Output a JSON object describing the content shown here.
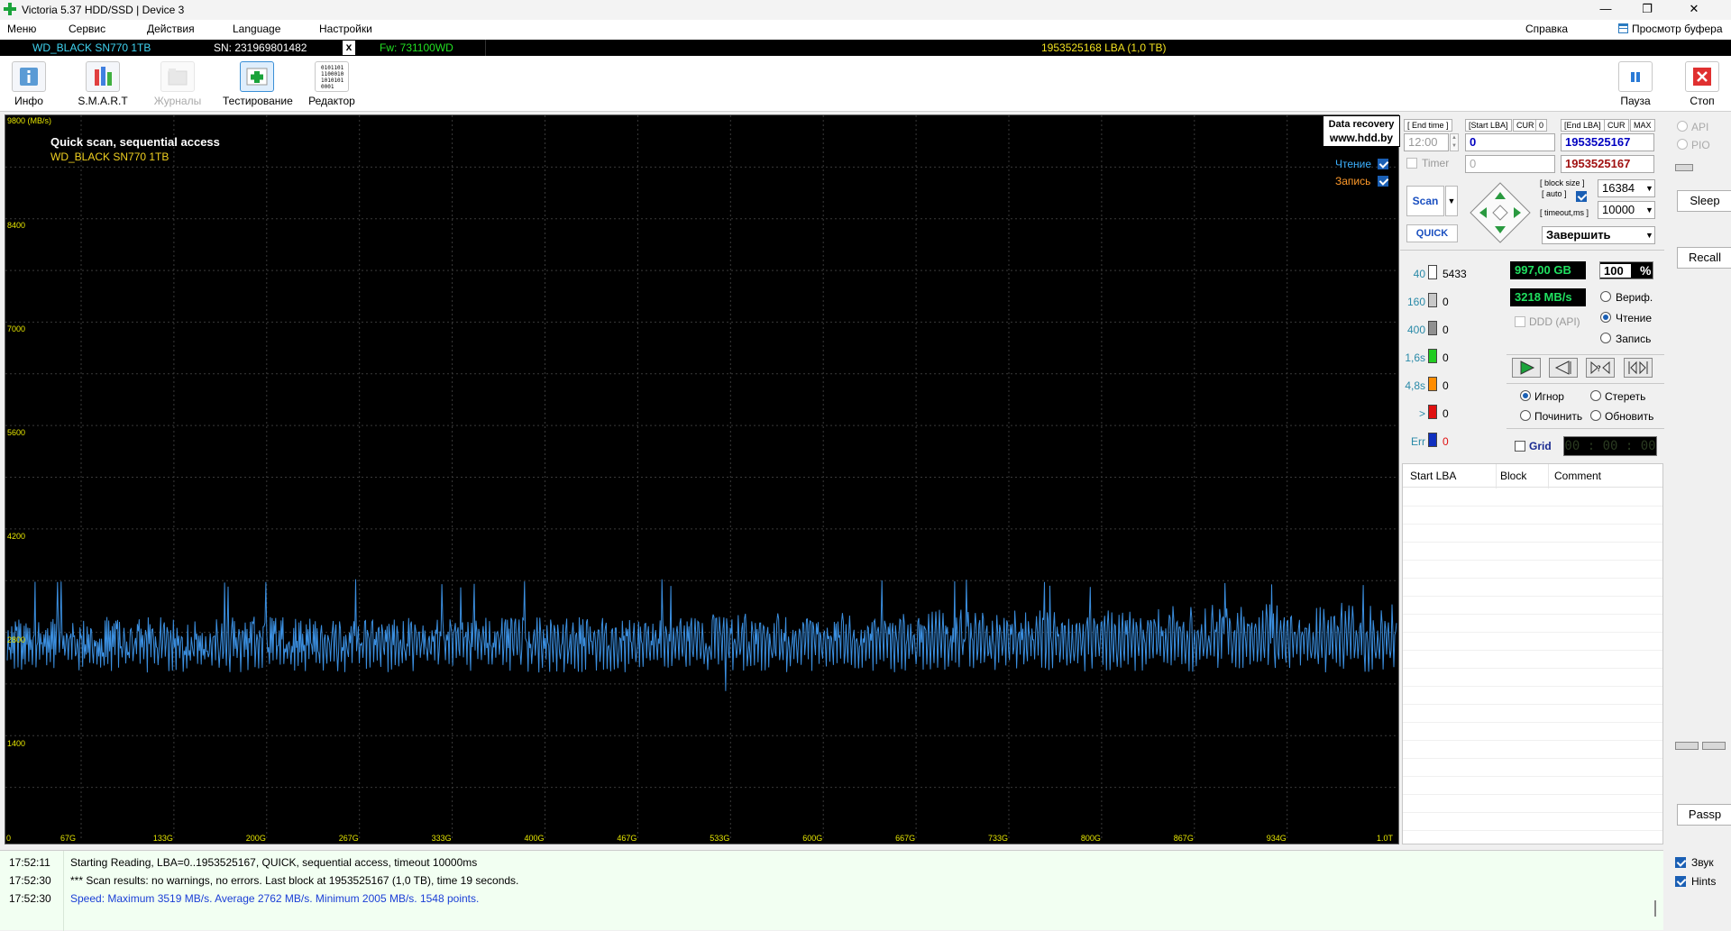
{
  "window": {
    "title": "Victoria 5.37 HDD/SSD | Device 3",
    "minimize": "—",
    "maximize": "❐",
    "close": "✕"
  },
  "menu": {
    "items": [
      "Меню",
      "Сервис",
      "Действия",
      "Language",
      "Настройки"
    ],
    "help": "Справка",
    "buffer": "Просмотр буфера"
  },
  "device": {
    "model": "WD_BLACK SN770 1TB",
    "serial": "SN: 231969801482",
    "x": "x",
    "firmware": "Fw: 731100WD",
    "lba": "1953525168 LBA (1,0 TB)"
  },
  "toolbar": {
    "info": "Инфо",
    "smart": "S.M.A.R.T",
    "logs": "Журналы",
    "testing": "Тестирование",
    "editor": "Редактор",
    "editor_glyph": "0101101\n1100010\n1010101\n0001",
    "pause": "Пауза",
    "stop": "Стоп"
  },
  "chart": {
    "title": "Quick scan, sequential access",
    "subtitle": "WD_BLACK SN770 1TB",
    "ylabel": "9800 (MB/s)",
    "legend_read": "Чтение",
    "legend_write": "Запись",
    "watermark_line1": "Data recovery",
    "watermark_line2": "www.hdd.by",
    "ytick_labels": [
      "8400",
      "7000",
      "5600",
      "4200",
      "2800",
      "1400"
    ],
    "xtick_labels": [
      "0",
      "67G",
      "133G",
      "200G",
      "267G",
      "333G",
      "400G",
      "467G",
      "533G",
      "600G",
      "667G",
      "733G",
      "800G",
      "867G",
      "934G",
      "1.0T"
    ]
  },
  "chart_data": {
    "type": "line",
    "title": "Quick scan, sequential access",
    "subtitle": "WD_BLACK SN770 1TB",
    "xlabel": "",
    "ylabel": "MB/s",
    "ylim": [
      0,
      9800
    ],
    "yticks": [
      1400,
      2800,
      4200,
      5600,
      7000,
      8400,
      9800
    ],
    "xticks": [
      "0",
      "67G",
      "133G",
      "200G",
      "267G",
      "333G",
      "400G",
      "467G",
      "533G",
      "600G",
      "667G",
      "733G",
      "800G",
      "867G",
      "934G",
      "1.0T"
    ],
    "grid": true,
    "legend_position": "top-right",
    "series": [
      {
        "name": "Чтение",
        "color": "#3b8fe0",
        "min": 2005,
        "max": 3519,
        "average": 2762,
        "points": 1548
      }
    ]
  },
  "panel": {
    "end_time_hdr": "[ End time ]",
    "start_lba_hdr": "[Start LBA]",
    "cur": "CUR",
    "cur_val": "0",
    "end_lba_hdr": "[End LBA]",
    "cur2": "CUR",
    "max": "MAX",
    "end_time": "12:00",
    "start_lba": "0",
    "end_lba": "1953525167",
    "timer_label": "Timer",
    "timer_value": "0",
    "end_lba2": "1953525167",
    "scan": "Scan",
    "quick": "QUICK",
    "block_size_label": "[ block size ]",
    "auto_label": "[ auto ]",
    "block_size": "16384",
    "timeout_label": "[ timeout,ms ]",
    "timeout": "10000",
    "finish": "Завершить",
    "bars": [
      {
        "label": "40",
        "value": "5433",
        "color": "#ffffff"
      },
      {
        "label": "160",
        "value": "0",
        "color": "#c8c8c8"
      },
      {
        "label": "400",
        "value": "0",
        "color": "#909090"
      },
      {
        "label": "1,6s",
        "value": "0",
        "color": "#22cc22"
      },
      {
        "label": "4,8s",
        "value": "0",
        "color": "#ff8c00"
      },
      {
        "label": ">",
        "value": "0",
        "color": "#e01010"
      },
      {
        "label": "Err",
        "value": "0",
        "color": "#1030c0"
      }
    ],
    "gb": "997,00 GB",
    "percent": "100",
    "pct_sign": "%",
    "speed": "3218 MB/s",
    "ddd": "DDD (API)",
    "verify": "Вериф.",
    "read": "Чтение",
    "write": "Запись",
    "ignore": "Игнор",
    "erase": "Стереть",
    "repair": "Починить",
    "refresh": "Обновить",
    "grid": "Grid",
    "clock": "00 : 00 : 00",
    "table_headers": [
      "Start LBA",
      "Block",
      "Comment"
    ]
  },
  "side": {
    "api": "API",
    "pio": "PIO",
    "sleep": "Sleep",
    "recall": "Recall",
    "passp": "Passp",
    "sound": "Звук",
    "hints": "Hints"
  },
  "log": [
    {
      "time": "17:52:11",
      "text": "Starting Reading, LBA=0..1953525167, QUICK, sequential access, timeout 10000ms",
      "color": "#000000"
    },
    {
      "time": "17:52:30",
      "text": "*** Scan results: no warnings, no errors. Last block at 1953525167 (1,0 TB), time 19 seconds.",
      "color": "#000000"
    },
    {
      "time": "17:52:30",
      "text": "Speed: Maximum 3519 MB/s. Average 2762 MB/s. Minimum 2005 MB/s. 1548 points.",
      "color": "#1a3fd6"
    }
  ]
}
